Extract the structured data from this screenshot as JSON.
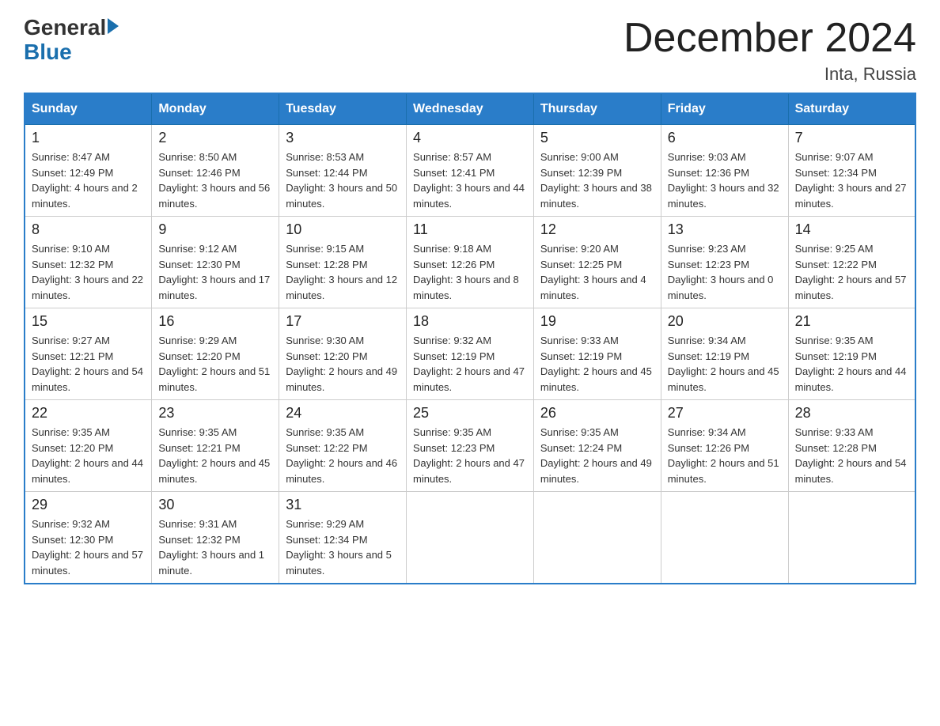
{
  "header": {
    "logo": {
      "general": "General",
      "arrow": "▶",
      "blue": "Blue"
    },
    "title": "December 2024",
    "location": "Inta, Russia"
  },
  "days_of_week": [
    "Sunday",
    "Monday",
    "Tuesday",
    "Wednesday",
    "Thursday",
    "Friday",
    "Saturday"
  ],
  "weeks": [
    [
      {
        "day": "1",
        "sunrise": "Sunrise: 8:47 AM",
        "sunset": "Sunset: 12:49 PM",
        "daylight": "Daylight: 4 hours and 2 minutes."
      },
      {
        "day": "2",
        "sunrise": "Sunrise: 8:50 AM",
        "sunset": "Sunset: 12:46 PM",
        "daylight": "Daylight: 3 hours and 56 minutes."
      },
      {
        "day": "3",
        "sunrise": "Sunrise: 8:53 AM",
        "sunset": "Sunset: 12:44 PM",
        "daylight": "Daylight: 3 hours and 50 minutes."
      },
      {
        "day": "4",
        "sunrise": "Sunrise: 8:57 AM",
        "sunset": "Sunset: 12:41 PM",
        "daylight": "Daylight: 3 hours and 44 minutes."
      },
      {
        "day": "5",
        "sunrise": "Sunrise: 9:00 AM",
        "sunset": "Sunset: 12:39 PM",
        "daylight": "Daylight: 3 hours and 38 minutes."
      },
      {
        "day": "6",
        "sunrise": "Sunrise: 9:03 AM",
        "sunset": "Sunset: 12:36 PM",
        "daylight": "Daylight: 3 hours and 32 minutes."
      },
      {
        "day": "7",
        "sunrise": "Sunrise: 9:07 AM",
        "sunset": "Sunset: 12:34 PM",
        "daylight": "Daylight: 3 hours and 27 minutes."
      }
    ],
    [
      {
        "day": "8",
        "sunrise": "Sunrise: 9:10 AM",
        "sunset": "Sunset: 12:32 PM",
        "daylight": "Daylight: 3 hours and 22 minutes."
      },
      {
        "day": "9",
        "sunrise": "Sunrise: 9:12 AM",
        "sunset": "Sunset: 12:30 PM",
        "daylight": "Daylight: 3 hours and 17 minutes."
      },
      {
        "day": "10",
        "sunrise": "Sunrise: 9:15 AM",
        "sunset": "Sunset: 12:28 PM",
        "daylight": "Daylight: 3 hours and 12 minutes."
      },
      {
        "day": "11",
        "sunrise": "Sunrise: 9:18 AM",
        "sunset": "Sunset: 12:26 PM",
        "daylight": "Daylight: 3 hours and 8 minutes."
      },
      {
        "day": "12",
        "sunrise": "Sunrise: 9:20 AM",
        "sunset": "Sunset: 12:25 PM",
        "daylight": "Daylight: 3 hours and 4 minutes."
      },
      {
        "day": "13",
        "sunrise": "Sunrise: 9:23 AM",
        "sunset": "Sunset: 12:23 PM",
        "daylight": "Daylight: 3 hours and 0 minutes."
      },
      {
        "day": "14",
        "sunrise": "Sunrise: 9:25 AM",
        "sunset": "Sunset: 12:22 PM",
        "daylight": "Daylight: 2 hours and 57 minutes."
      }
    ],
    [
      {
        "day": "15",
        "sunrise": "Sunrise: 9:27 AM",
        "sunset": "Sunset: 12:21 PM",
        "daylight": "Daylight: 2 hours and 54 minutes."
      },
      {
        "day": "16",
        "sunrise": "Sunrise: 9:29 AM",
        "sunset": "Sunset: 12:20 PM",
        "daylight": "Daylight: 2 hours and 51 minutes."
      },
      {
        "day": "17",
        "sunrise": "Sunrise: 9:30 AM",
        "sunset": "Sunset: 12:20 PM",
        "daylight": "Daylight: 2 hours and 49 minutes."
      },
      {
        "day": "18",
        "sunrise": "Sunrise: 9:32 AM",
        "sunset": "Sunset: 12:19 PM",
        "daylight": "Daylight: 2 hours and 47 minutes."
      },
      {
        "day": "19",
        "sunrise": "Sunrise: 9:33 AM",
        "sunset": "Sunset: 12:19 PM",
        "daylight": "Daylight: 2 hours and 45 minutes."
      },
      {
        "day": "20",
        "sunrise": "Sunrise: 9:34 AM",
        "sunset": "Sunset: 12:19 PM",
        "daylight": "Daylight: 2 hours and 45 minutes."
      },
      {
        "day": "21",
        "sunrise": "Sunrise: 9:35 AM",
        "sunset": "Sunset: 12:19 PM",
        "daylight": "Daylight: 2 hours and 44 minutes."
      }
    ],
    [
      {
        "day": "22",
        "sunrise": "Sunrise: 9:35 AM",
        "sunset": "Sunset: 12:20 PM",
        "daylight": "Daylight: 2 hours and 44 minutes."
      },
      {
        "day": "23",
        "sunrise": "Sunrise: 9:35 AM",
        "sunset": "Sunset: 12:21 PM",
        "daylight": "Daylight: 2 hours and 45 minutes."
      },
      {
        "day": "24",
        "sunrise": "Sunrise: 9:35 AM",
        "sunset": "Sunset: 12:22 PM",
        "daylight": "Daylight: 2 hours and 46 minutes."
      },
      {
        "day": "25",
        "sunrise": "Sunrise: 9:35 AM",
        "sunset": "Sunset: 12:23 PM",
        "daylight": "Daylight: 2 hours and 47 minutes."
      },
      {
        "day": "26",
        "sunrise": "Sunrise: 9:35 AM",
        "sunset": "Sunset: 12:24 PM",
        "daylight": "Daylight: 2 hours and 49 minutes."
      },
      {
        "day": "27",
        "sunrise": "Sunrise: 9:34 AM",
        "sunset": "Sunset: 12:26 PM",
        "daylight": "Daylight: 2 hours and 51 minutes."
      },
      {
        "day": "28",
        "sunrise": "Sunrise: 9:33 AM",
        "sunset": "Sunset: 12:28 PM",
        "daylight": "Daylight: 2 hours and 54 minutes."
      }
    ],
    [
      {
        "day": "29",
        "sunrise": "Sunrise: 9:32 AM",
        "sunset": "Sunset: 12:30 PM",
        "daylight": "Daylight: 2 hours and 57 minutes."
      },
      {
        "day": "30",
        "sunrise": "Sunrise: 9:31 AM",
        "sunset": "Sunset: 12:32 PM",
        "daylight": "Daylight: 3 hours and 1 minute."
      },
      {
        "day": "31",
        "sunrise": "Sunrise: 9:29 AM",
        "sunset": "Sunset: 12:34 PM",
        "daylight": "Daylight: 3 hours and 5 minutes."
      },
      null,
      null,
      null,
      null
    ]
  ]
}
